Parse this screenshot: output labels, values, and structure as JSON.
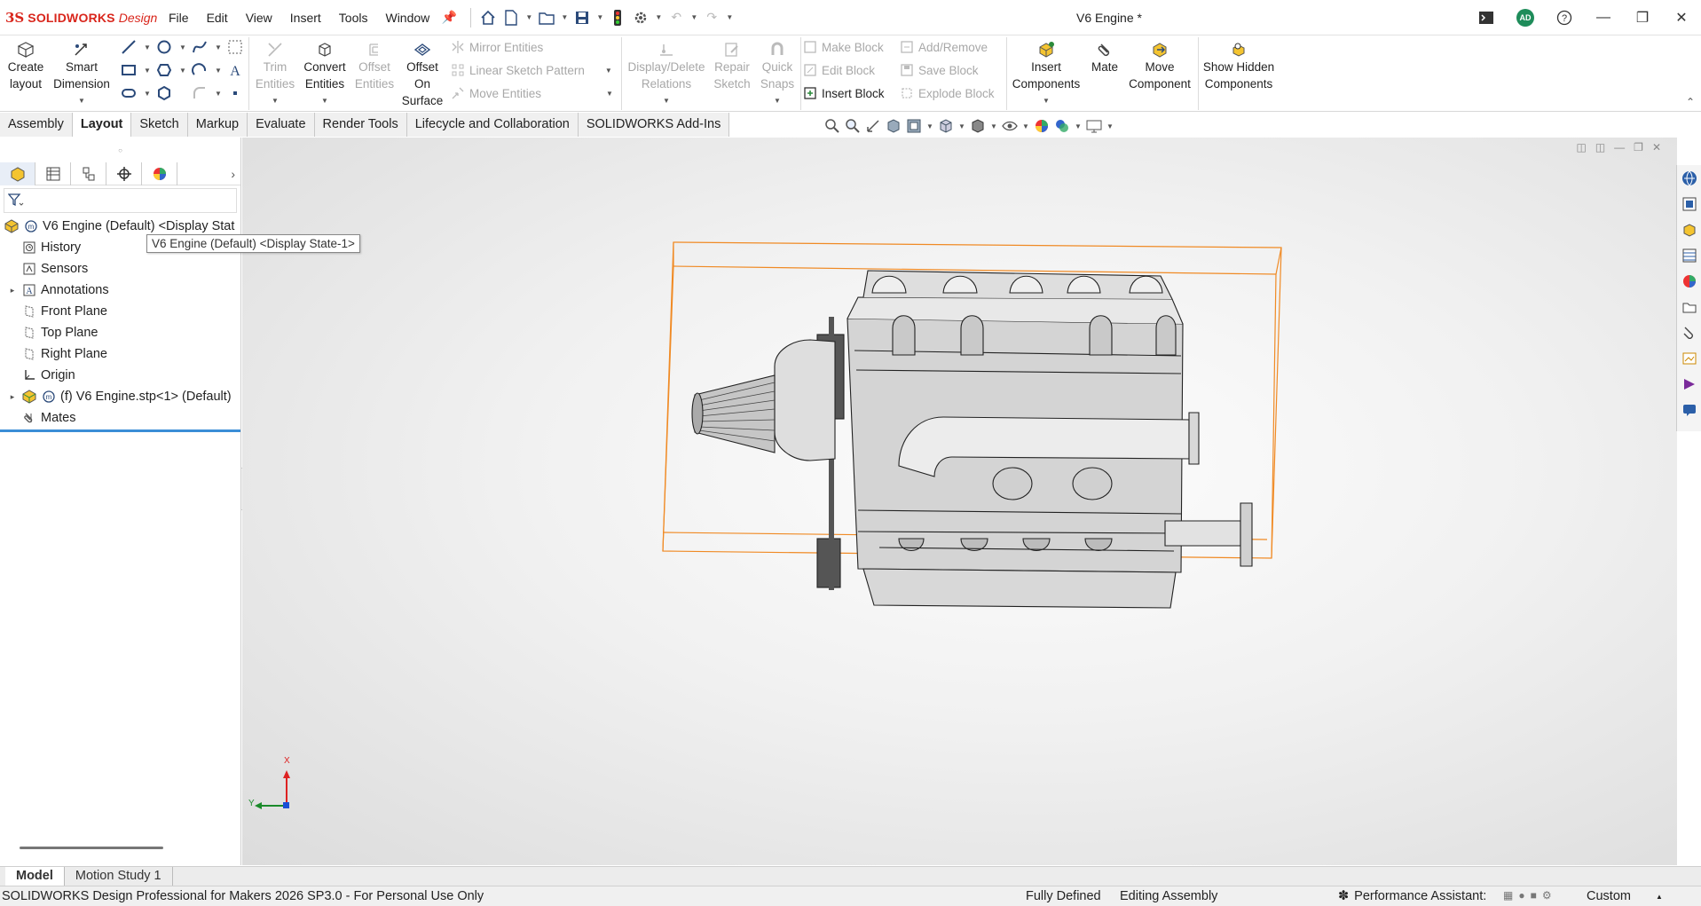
{
  "app": {
    "logo_mark": "3S",
    "logo_text": "SOLIDWORKS",
    "logo_edition": "Design",
    "document_title": "V6 Engine *"
  },
  "menu": [
    "File",
    "Edit",
    "View",
    "Insert",
    "Tools",
    "Window"
  ],
  "window_controls": {
    "avatar_initials": "AD"
  },
  "command_manager": {
    "create_layout": "Create layout",
    "smart_dimension": "Smart Dimension",
    "trim_entities": "Trim Entities",
    "convert_entities": "Convert Entities",
    "offset_entities": "Offset Entities",
    "offset_on_surface": "Offset On Surface",
    "mirror_entities": "Mirror Entities",
    "linear_sketch_pattern": "Linear Sketch Pattern",
    "move_entities": "Move Entities",
    "display_delete_relations": "Display/Delete Relations",
    "repair_sketch": "Repair Sketch",
    "quick_snaps": "Quick Snaps",
    "make_block": "Make Block",
    "edit_block": "Edit Block",
    "insert_block": "Insert Block",
    "add_remove": "Add/Remove",
    "save_block": "Save Block",
    "explode_block": "Explode Block",
    "insert_components": "Insert Components",
    "mate": "Mate",
    "move_component": "Move Component",
    "show_hidden_components": "Show Hidden Components"
  },
  "tabs": [
    {
      "label": "Assembly",
      "active": false
    },
    {
      "label": "Layout",
      "active": true
    },
    {
      "label": "Sketch",
      "active": false
    },
    {
      "label": "Markup",
      "active": false
    },
    {
      "label": "Evaluate",
      "active": false
    },
    {
      "label": "Render Tools",
      "active": false
    },
    {
      "label": "Lifecycle and Collaboration",
      "active": false
    },
    {
      "label": "SOLIDWORKS Add-Ins",
      "active": false
    }
  ],
  "tree": {
    "root": "V6 Engine (Default) <Display Stat",
    "tooltip": "V6 Engine (Default) <Display State-1>",
    "items": [
      {
        "label": "History",
        "icon": "history-icon",
        "expandable": false
      },
      {
        "label": "Sensors",
        "icon": "sensors-icon",
        "expandable": false
      },
      {
        "label": "Annotations",
        "icon": "annotations-icon",
        "expandable": true
      },
      {
        "label": "Front Plane",
        "icon": "plane-icon",
        "expandable": false
      },
      {
        "label": "Top Plane",
        "icon": "plane-icon",
        "expandable": false
      },
      {
        "label": "Right Plane",
        "icon": "plane-icon",
        "expandable": false
      },
      {
        "label": "Origin",
        "icon": "origin-icon",
        "expandable": false
      },
      {
        "label": "(f) V6 Engine.stp<1> (Default)",
        "icon": "component-icon",
        "expandable": true
      },
      {
        "label": "Mates",
        "icon": "mates-icon",
        "expandable": false
      }
    ]
  },
  "triad": {
    "x": "X",
    "y": "Y"
  },
  "bottom_tabs": [
    {
      "label": "Model",
      "active": true
    },
    {
      "label": "Motion Study 1",
      "active": false
    }
  ],
  "status": {
    "product": "SOLIDWORKS Design Professional for Makers 2026 SP3.0 - For Personal Use Only",
    "definition": "Fully Defined",
    "mode": "Editing Assembly",
    "performance": "Performance Assistant:",
    "units": "Custom"
  },
  "colors": {
    "brand": "#d9261c",
    "selection_box": "#f08a24",
    "tree_separator": "#3b8ed6"
  }
}
